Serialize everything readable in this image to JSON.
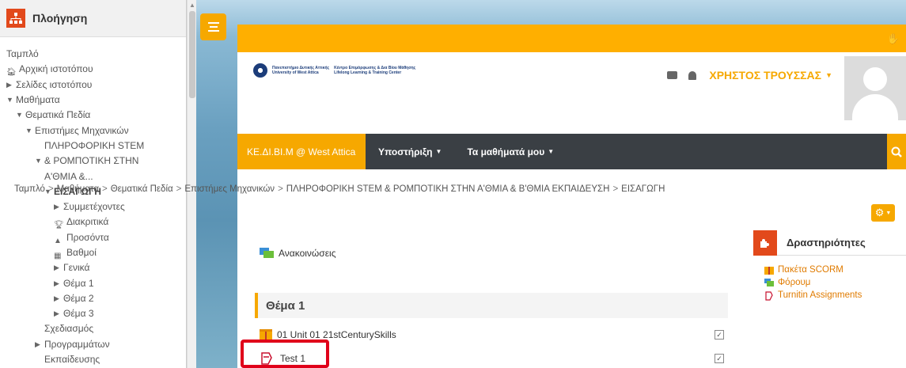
{
  "nav": {
    "title": "Πλοήγηση",
    "items": [
      {
        "label": "Ταμπλό",
        "indent": 0,
        "tri": "",
        "icon": ""
      },
      {
        "label": "Αρχική ιστοτόπου",
        "indent": 0,
        "tri": "",
        "icon": "home-icon"
      },
      {
        "label": "Σελίδες ιστοτόπου",
        "indent": 0,
        "tri": "▶",
        "icon": ""
      },
      {
        "label": "Μαθήματα",
        "indent": 0,
        "tri": "▼",
        "icon": ""
      },
      {
        "label": "Θεματικά Πεδία",
        "indent": 1,
        "tri": "▼",
        "icon": ""
      },
      {
        "label": "Επιστήμες Μηχανικών",
        "indent": 2,
        "tri": "▼",
        "icon": ""
      },
      {
        "label": "ΠΛΗΡΟΦΟΡΙΚΗ STEM",
        "indent": 4,
        "tri": "",
        "icon": ""
      },
      {
        "label": "& ΡΟΜΠΟΤΙΚΗ ΣΤΗΝ",
        "indent": 3,
        "tri": "▼",
        "icon": ""
      },
      {
        "label": "Α'ΘΜΙΑ &...",
        "indent": 4,
        "tri": "",
        "icon": ""
      },
      {
        "label": "ΕΙΣΑΓΩΓΗ",
        "indent": 4,
        "tri": "▼",
        "icon": "",
        "bold": true
      },
      {
        "label": "Συμμετέχοντες",
        "indent": 5,
        "tri": "▶",
        "icon": ""
      },
      {
        "label": "Διακριτικά",
        "indent": 5,
        "tri": "",
        "icon": "trophy-icon"
      },
      {
        "label": "Προσόντα",
        "indent": 5,
        "tri": "",
        "icon": "competency-icon"
      },
      {
        "label": "Βαθμοί",
        "indent": 5,
        "tri": "",
        "icon": "grades-icon"
      },
      {
        "label": "Γενικά",
        "indent": 5,
        "tri": "▶",
        "icon": ""
      },
      {
        "label": "Θέμα 1",
        "indent": 5,
        "tri": "▶",
        "icon": ""
      },
      {
        "label": "Θέμα 2",
        "indent": 5,
        "tri": "▶",
        "icon": ""
      },
      {
        "label": "Θέμα 3",
        "indent": 5,
        "tri": "▶",
        "icon": ""
      },
      {
        "label": "Σχεδιασμός",
        "indent": 4,
        "tri": "",
        "icon": ""
      },
      {
        "label": "Προγραμμάτων",
        "indent": 3,
        "tri": "▶",
        "icon": ""
      },
      {
        "label": "Εκπαίδευσης",
        "indent": 4,
        "tri": "",
        "icon": ""
      }
    ]
  },
  "header": {
    "logo_line1": "Πανεπιστήμιο Δυτικής Αττικής",
    "logo_line2": "University of West Attica",
    "logo_line3": "Κέντρο Επιμόρφωσης & Δια Βίου Μάθησης",
    "logo_line4": "Lifelong Learning & Training Center",
    "user_name": "ΧΡΗΣΤΟΣ ΤΡΟΥΣΣΑΣ"
  },
  "navbar": {
    "brand": "ΚΕ.ΔΙ.ΒΙ.Μ @ West Attica",
    "items": [
      "Υποστήριξη",
      "Τα μαθήματά μου"
    ]
  },
  "breadcrumb": [
    "Ταμπλό",
    "Μαθήματα",
    "Θεματικά Πεδία",
    "Επιστήμες Μηχανικών",
    "ΠΛΗΡΟΦΟΡΙΚΗ STEM & ΡΟΜΠΟΤΙΚΗ ΣΤΗΝ Α'ΘΜΙΑ & Β'ΘΜΙΑ ΕΚΠΑΙΔΕΥΣΗ",
    "ΕΙΣΑΓΩΓΗ"
  ],
  "course": {
    "announcements": "Ανακοινώσεις",
    "section_title": "Θέμα 1",
    "activity1": "01 Unit 01 21stCenturySkills",
    "activity2": "Test 1"
  },
  "activities_block": {
    "title": "Δραστηριότητες",
    "items": [
      "Πακέτα SCORM",
      "Φόρουμ",
      "Turnitin Assignments"
    ]
  },
  "colors": {
    "accent": "#f6a800",
    "navbar": "#3a3f44",
    "block_icon": "#e2491b",
    "highlight": "#e0001a"
  }
}
